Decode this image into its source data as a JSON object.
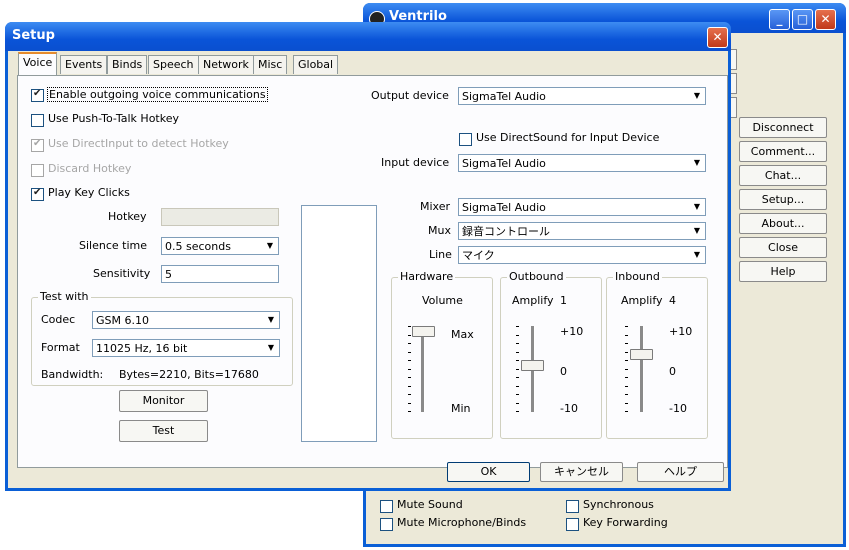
{
  "ventrilo": {
    "title": "Ventrilo",
    "buttons": [
      "Disconnect",
      "Comment...",
      "Chat...",
      "Setup...",
      "About...",
      "Close",
      "Help"
    ],
    "checkboxes": {
      "mute_sound": "Mute Sound",
      "mute_microphone_binds": "Mute Microphone/Binds",
      "synchronous": "Synchronous",
      "key_forwarding": "Key Forwarding"
    }
  },
  "setup": {
    "title": "Setup",
    "tabs": [
      "Voice",
      "Events",
      "Binds",
      "Speech",
      "Network",
      "Misc",
      "Global"
    ],
    "active_tab": "Voice",
    "left": {
      "enable_outgoing": {
        "label": "Enable outgoing voice communications",
        "checked": true
      },
      "use_ptt": {
        "label": "Use Push-To-Talk Hotkey",
        "checked": false
      },
      "use_directinput": {
        "label": "Use DirectInput to detect Hotkey",
        "checked": true,
        "disabled": true
      },
      "discard_hotkey": {
        "label": "Discard Hotkey",
        "checked": false,
        "disabled": true
      },
      "play_key_clicks": {
        "label": "Play Key Clicks",
        "checked": true
      },
      "hotkey_label": "Hotkey",
      "hotkey_value": "",
      "silence_label": "Silence time",
      "silence_value": "0.5 seconds",
      "sensitivity_label": "Sensitivity",
      "sensitivity_value": "5"
    },
    "test_with": {
      "title": "Test with",
      "codec_label": "Codec",
      "codec_value": "GSM 6.10",
      "format_label": "Format",
      "format_value": "11025 Hz, 16 bit",
      "bandwidth_label": "Bandwidth:",
      "bandwidth_value": "Bytes=2210, Bits=17680",
      "monitor_button": "Monitor",
      "test_button": "Test"
    },
    "right": {
      "output_device_label": "Output device",
      "output_device_value": "SigmaTel Audio",
      "use_directsound_label": "Use DirectSound for Input Device",
      "input_device_label": "Input device",
      "input_device_value": "SigmaTel Audio",
      "mixer_label": "Mixer",
      "mixer_value": "SigmaTel Audio",
      "mux_label": "Mux",
      "mux_value": "録音コントロール",
      "line_label": "Line",
      "line_value": "マイク"
    },
    "hardware": {
      "title": "Hardware",
      "caption": "Volume",
      "max": "Max",
      "min": "Min",
      "level": 1.0
    },
    "outbound": {
      "title": "Outbound",
      "caption": "Amplify",
      "amplify_value": "1",
      "plus": "+10",
      "zero": "0",
      "minus": "-10",
      "value": 1
    },
    "inbound": {
      "title": "Inbound",
      "caption": "Amplify",
      "amplify_value": "4",
      "plus": "+10",
      "zero": "0",
      "minus": "-10",
      "value": 4
    },
    "footer": {
      "ok": "OK",
      "cancel": "キャンセル",
      "help": "ヘルプ"
    }
  }
}
